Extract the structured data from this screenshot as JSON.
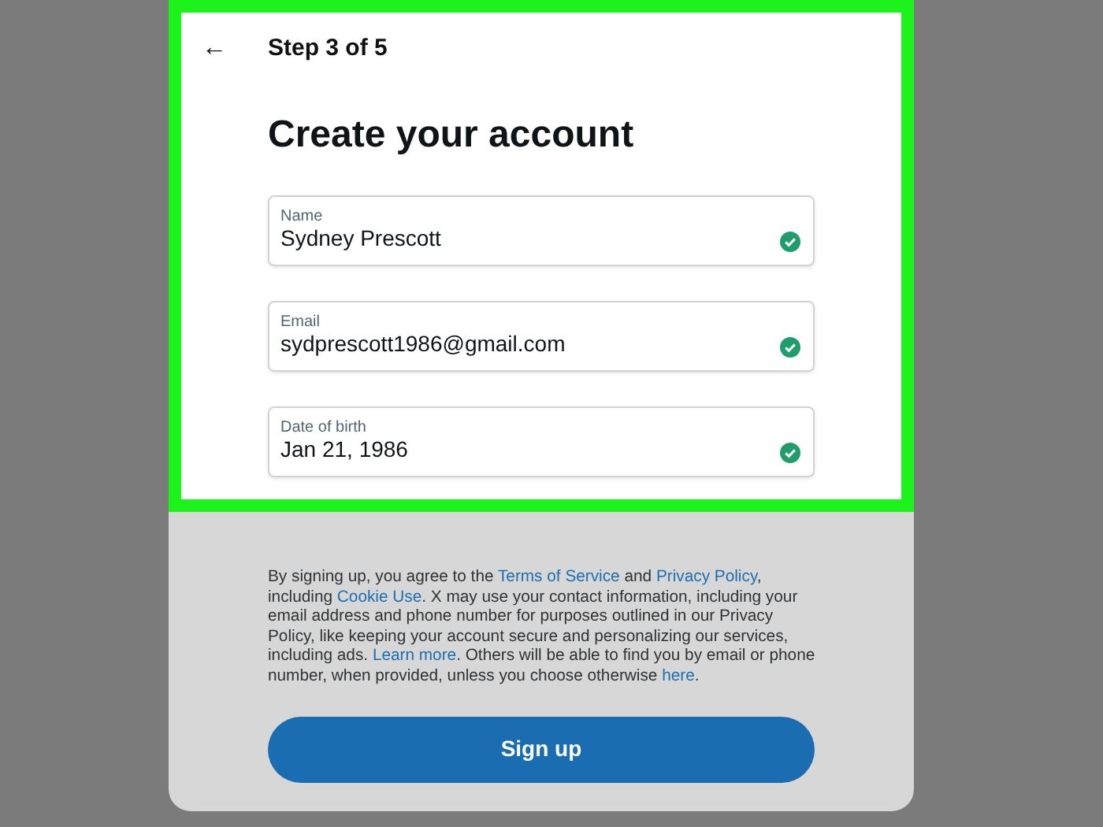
{
  "header": {
    "back": "←",
    "step": "Step 3 of 5"
  },
  "form": {
    "highlighted": true,
    "title": "Create your account",
    "fields": [
      {
        "label": "Name",
        "value": "Sydney Prescott",
        "valid": true
      },
      {
        "label": "Email",
        "value": "sydprescott1986@gmail.com",
        "valid": true
      },
      {
        "label": "Date of birth",
        "value": "Jan 21, 1986",
        "valid": true
      }
    ]
  },
  "legal": [
    {
      "kind": "text",
      "text": "By signing up, you agree to the "
    },
    {
      "kind": "link",
      "text": "Terms of Service"
    },
    {
      "kind": "text",
      "text": " and "
    },
    {
      "kind": "link",
      "text": "Privacy Policy"
    },
    {
      "kind": "text",
      "text": ", including "
    },
    {
      "kind": "link",
      "text": "Cookie Use"
    },
    {
      "kind": "text",
      "text": ". X may use your contact information, including your email address and phone number for purposes outlined in our Privacy Policy, like keeping your account secure and personalizing our services, including ads. "
    },
    {
      "kind": "link",
      "text": "Learn more"
    },
    {
      "kind": "text",
      "text": ". Others will be able to find you by email or phone number, when provided, unless you choose otherwise "
    },
    {
      "kind": "link",
      "text": "here"
    },
    {
      "kind": "text",
      "text": "."
    }
  ],
  "button": "Sign up"
}
